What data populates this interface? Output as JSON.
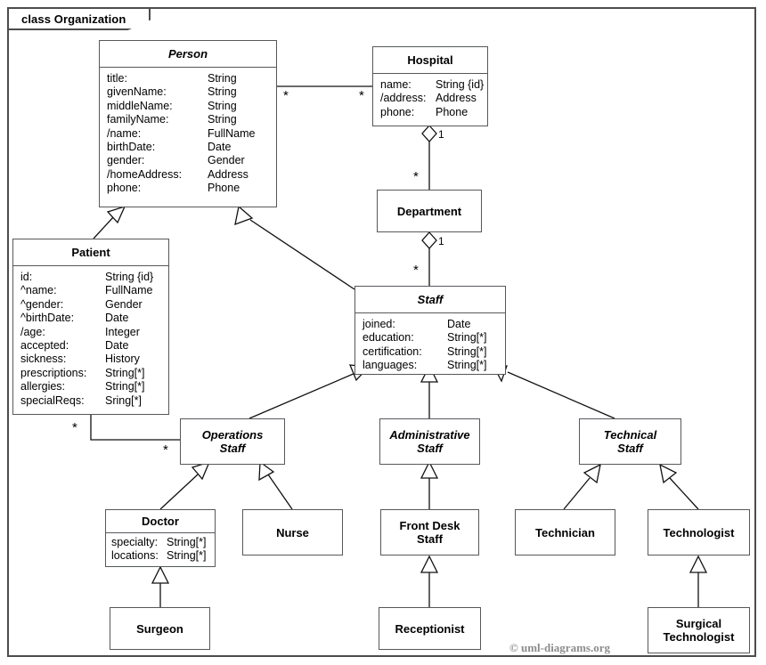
{
  "diagram": {
    "frame_label": "class Organization",
    "copyright": "© uml-diagrams.org"
  },
  "classes": {
    "person": {
      "name": "Person",
      "attributes": [
        {
          "name": "title:",
          "type": "String"
        },
        {
          "name": "givenName:",
          "type": "String"
        },
        {
          "name": "middleName:",
          "type": "String"
        },
        {
          "name": "familyName:",
          "type": "String"
        },
        {
          "name": "/name:",
          "type": "FullName"
        },
        {
          "name": "birthDate:",
          "type": "Date"
        },
        {
          "name": "gender:",
          "type": "Gender"
        },
        {
          "name": "/homeAddress:",
          "type": "Address"
        },
        {
          "name": "phone:",
          "type": "Phone"
        }
      ]
    },
    "hospital": {
      "name": "Hospital",
      "attributes": [
        {
          "name": "name:",
          "type": "String {id}"
        },
        {
          "name": "/address:",
          "type": "Address"
        },
        {
          "name": "phone:",
          "type": "Phone"
        }
      ]
    },
    "department": {
      "name": "Department"
    },
    "patient": {
      "name": "Patient",
      "attributes": [
        {
          "name": "id:",
          "type": "String {id}"
        },
        {
          "name": "^name:",
          "type": "FullName"
        },
        {
          "name": "^gender:",
          "type": "Gender"
        },
        {
          "name": "^birthDate:",
          "type": "Date"
        },
        {
          "name": "/age:",
          "type": "Integer"
        },
        {
          "name": "accepted:",
          "type": "Date"
        },
        {
          "name": "sickness:",
          "type": "History"
        },
        {
          "name": "prescriptions:",
          "type": "String[*]"
        },
        {
          "name": "allergies:",
          "type": "String[*]"
        },
        {
          "name": "specialReqs:",
          "type": "Sring[*]"
        }
      ]
    },
    "staff": {
      "name": "Staff",
      "attributes": [
        {
          "name": "joined:",
          "type": "Date"
        },
        {
          "name": "education:",
          "type": "String[*]"
        },
        {
          "name": "certification:",
          "type": "String[*]"
        },
        {
          "name": "languages:",
          "type": "String[*]"
        }
      ]
    },
    "operations_staff": {
      "name": "Operations\nStaff"
    },
    "administrative_staff": {
      "name": "Administrative\nStaff"
    },
    "technical_staff": {
      "name": "Technical\nStaff"
    },
    "doctor": {
      "name": "Doctor",
      "attributes": [
        {
          "name": "specialty:",
          "type": "String[*]"
        },
        {
          "name": "locations:",
          "type": "String[*]"
        }
      ]
    },
    "nurse": {
      "name": "Nurse"
    },
    "front_desk_staff": {
      "name": "Front Desk\nStaff"
    },
    "technician": {
      "name": "Technician"
    },
    "technologist": {
      "name": "Technologist"
    },
    "surgeon": {
      "name": "Surgeon"
    },
    "receptionist": {
      "name": "Receptionist"
    },
    "surgical_technologist": {
      "name": "Surgical\nTechnologist"
    }
  },
  "multiplicities": {
    "person_hospital_src": "*",
    "person_hospital_tgt": "*",
    "hospital_department_hospital_end": "1",
    "hospital_department_dept_end": "*",
    "department_staff_dept_end": "1",
    "department_staff_staff_end": "*",
    "patient_ops_patient_end": "*",
    "patient_ops_ops_end": "*"
  },
  "chart_data": {
    "type": "diagram",
    "notation": "UML class diagram",
    "title": "class Organization",
    "nodes": [
      "Person",
      "Hospital",
      "Department",
      "Patient",
      "Staff",
      "Operations Staff",
      "Administrative Staff",
      "Technical Staff",
      "Doctor",
      "Nurse",
      "Front Desk Staff",
      "Technician",
      "Technologist",
      "Surgeon",
      "Receptionist",
      "Surgical Technologist"
    ],
    "abstract_nodes": [
      "Person",
      "Staff",
      "Operations Staff",
      "Administrative Staff",
      "Technical Staff"
    ],
    "relationships": [
      {
        "type": "association",
        "from": "Person",
        "to": "Hospital",
        "from_multiplicity": "*",
        "to_multiplicity": "*"
      },
      {
        "type": "aggregation",
        "from": "Hospital",
        "to": "Department",
        "whole": "Hospital",
        "whole_multiplicity": "1",
        "part_multiplicity": "*"
      },
      {
        "type": "aggregation",
        "from": "Department",
        "to": "Staff",
        "whole": "Department",
        "whole_multiplicity": "1",
        "part_multiplicity": "*"
      },
      {
        "type": "association",
        "from": "Patient",
        "to": "Operations Staff",
        "from_multiplicity": "*",
        "to_multiplicity": "*"
      },
      {
        "type": "generalization",
        "from": "Patient",
        "to": "Person"
      },
      {
        "type": "generalization",
        "from": "Staff",
        "to": "Person"
      },
      {
        "type": "generalization",
        "from": "Operations Staff",
        "to": "Staff"
      },
      {
        "type": "generalization",
        "from": "Administrative Staff",
        "to": "Staff"
      },
      {
        "type": "generalization",
        "from": "Technical Staff",
        "to": "Staff"
      },
      {
        "type": "generalization",
        "from": "Doctor",
        "to": "Operations Staff"
      },
      {
        "type": "generalization",
        "from": "Nurse",
        "to": "Operations Staff"
      },
      {
        "type": "generalization",
        "from": "Front Desk Staff",
        "to": "Administrative Staff"
      },
      {
        "type": "generalization",
        "from": "Technician",
        "to": "Technical Staff"
      },
      {
        "type": "generalization",
        "from": "Technologist",
        "to": "Technical Staff"
      },
      {
        "type": "generalization",
        "from": "Surgeon",
        "to": "Doctor"
      },
      {
        "type": "generalization",
        "from": "Receptionist",
        "to": "Front Desk Staff"
      },
      {
        "type": "generalization",
        "from": "Surgical Technologist",
        "to": "Technologist"
      }
    ]
  }
}
